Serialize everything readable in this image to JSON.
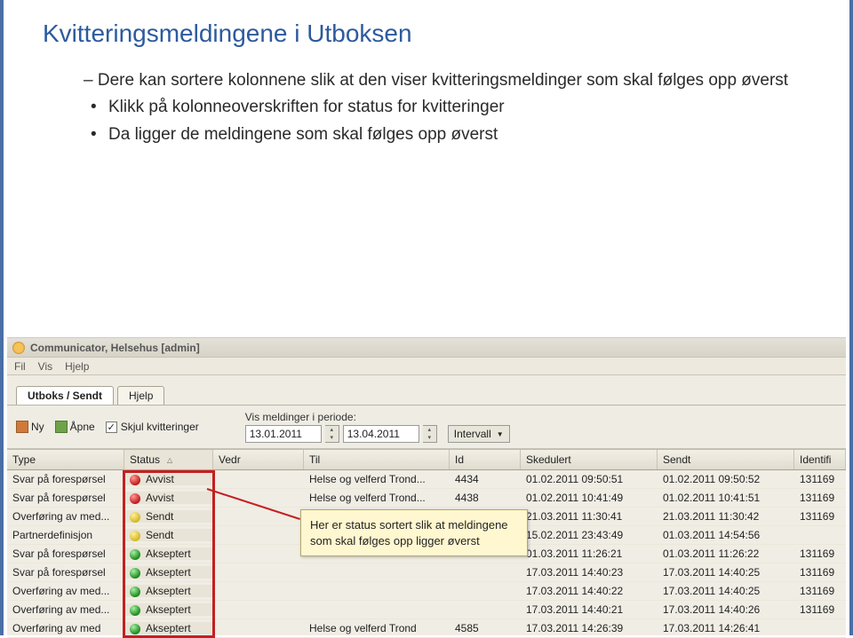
{
  "slide": {
    "title": "Kvitteringsmeldingene i Utboksen",
    "line1": "Dere kan sortere kolonnene slik at den viser kvitteringsmeldinger som skal følges opp øverst",
    "line2": "Klikk på kolonneoverskriften for status for kvitteringer",
    "line3": "Da ligger de meldingene som skal følges opp øverst"
  },
  "app": {
    "title": "Communicator, Helsehus [admin]",
    "menu": {
      "fil": "Fil",
      "vis": "Vis",
      "hjelp": "Hjelp"
    },
    "tabs": {
      "utboks": "Utboks / Sendt",
      "hjelp": "Hjelp"
    },
    "toolbar": {
      "ny": "Ny",
      "apne": "Åpne",
      "skjul": "Skjul kvitteringer",
      "periode_label": "Vis meldinger i periode:",
      "date_from": "13.01.2011",
      "date_to": "13.04.2011",
      "intervall": "Intervall"
    },
    "columns": {
      "type": "Type",
      "status": "Status",
      "vedr": "Vedr",
      "til": "Til",
      "id": "Id",
      "sked": "Skedulert",
      "sendt": "Sendt",
      "ident": "Identifi"
    },
    "callout": "Her er status sortert slik at meldingene som skal følges opp ligger øverst",
    "rows": [
      {
        "type": "Svar på forespørsel",
        "status": "Avvist",
        "dot": "red",
        "vedr": "",
        "til": "Helse og velferd Trond...",
        "id": "4434",
        "sked": "01.02.2011 09:50:51",
        "sendt": "01.02.2011 09:50:52",
        "ident": "131169"
      },
      {
        "type": "Svar på forespørsel",
        "status": "Avvist",
        "dot": "red",
        "vedr": "",
        "til": "Helse og velferd Trond...",
        "id": "4438",
        "sked": "01.02.2011 10:41:49",
        "sendt": "01.02.2011 10:41:51",
        "ident": "131169"
      },
      {
        "type": "Overføring av med...",
        "status": "Sendt",
        "dot": "yellow",
        "vedr": "",
        "til": "",
        "id": "",
        "sked": "21.03.2011 11:30:41",
        "sendt": "21.03.2011 11:30:42",
        "ident": "131169"
      },
      {
        "type": "Partnerdefinisjon",
        "status": "Sendt",
        "dot": "yellow",
        "vedr": "",
        "til": "",
        "id": "",
        "sked": "15.02.2011 23:43:49",
        "sendt": "01.03.2011 14:54:56",
        "ident": ""
      },
      {
        "type": "Svar på forespørsel",
        "status": "Akseptert",
        "dot": "green",
        "vedr": "",
        "til": "",
        "id": "",
        "sked": "01.03.2011 11:26:21",
        "sendt": "01.03.2011 11:26:22",
        "ident": "131169"
      },
      {
        "type": "Svar på forespørsel",
        "status": "Akseptert",
        "dot": "green",
        "vedr": "",
        "til": "",
        "id": "",
        "sked": "17.03.2011 14:40:23",
        "sendt": "17.03.2011 14:40:25",
        "ident": "131169"
      },
      {
        "type": "Overføring av med...",
        "status": "Akseptert",
        "dot": "green",
        "vedr": "",
        "til": "",
        "id": "",
        "sked": "17.03.2011 14:40:22",
        "sendt": "17.03.2011 14:40:25",
        "ident": "131169"
      },
      {
        "type": "Overføring av med...",
        "status": "Akseptert",
        "dot": "green",
        "vedr": "",
        "til": "",
        "id": "",
        "sked": "17.03.2011 14:40:21",
        "sendt": "17.03.2011 14:40:26",
        "ident": "131169"
      },
      {
        "type": "Overføring av med",
        "status": "Akseptert",
        "dot": "green",
        "vedr": "",
        "til": "Helse og velferd Trond",
        "id": "4585",
        "sked": "17.03.2011 14:26:39",
        "sendt": "17.03.2011 14:26:41",
        "ident": ""
      }
    ]
  }
}
